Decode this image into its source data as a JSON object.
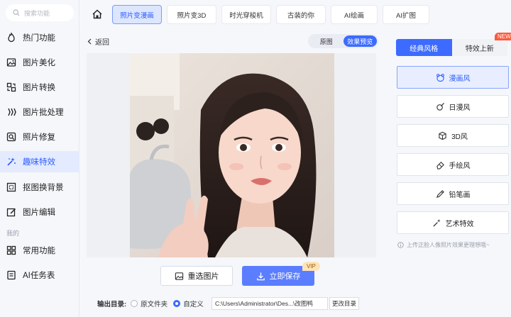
{
  "search": {
    "placeholder": "搜索功能"
  },
  "sidebar": {
    "items": [
      {
        "label": "热门功能",
        "icon": "flame-icon"
      },
      {
        "label": "图片美化",
        "icon": "image-beautify-icon"
      },
      {
        "label": "图片转换",
        "icon": "convert-icon"
      },
      {
        "label": "图片批处理",
        "icon": "batch-icon"
      },
      {
        "label": "照片修复",
        "icon": "repair-icon"
      },
      {
        "label": "趣味特效",
        "icon": "magic-icon"
      },
      {
        "label": "抠图换背景",
        "icon": "cutout-icon"
      },
      {
        "label": "图片编辑",
        "icon": "edit-icon"
      }
    ],
    "section_label": "我的",
    "my_items": [
      {
        "label": "常用功能",
        "icon": "grid-icon"
      },
      {
        "label": "AI任务表",
        "icon": "task-list-icon"
      }
    ],
    "active_index": 5
  },
  "tabs": [
    "照片变漫画",
    "照片变3D",
    "时光穿梭机",
    "古装的你",
    "AI绘画",
    "AI扩图"
  ],
  "active_tab": 0,
  "back_label": "返回",
  "view_toggle": {
    "original": "原图",
    "preview": "效果预览"
  },
  "actions": {
    "reselect": "重选图片",
    "save": "立即保存",
    "vip": "VIP"
  },
  "output": {
    "label": "输出目录:",
    "opt_source": "原文件夹",
    "opt_custom": "自定义",
    "path": "C:\\Users\\Administrator\\Des...\\改图鸭",
    "change": "更改目录"
  },
  "right_panel": {
    "tab_classic": "经典风格",
    "tab_new": "特效上新",
    "new_badge": "NEW",
    "styles": [
      "漫画风",
      "日漫风",
      "3D风",
      "手绘风",
      "铅笔画",
      "艺术特效"
    ],
    "active_style": 0,
    "hint": "上传正脸人像照片效果更理想哦~"
  },
  "colors": {
    "accent": "#3d6bff",
    "active_bg": "#e4ebff"
  }
}
